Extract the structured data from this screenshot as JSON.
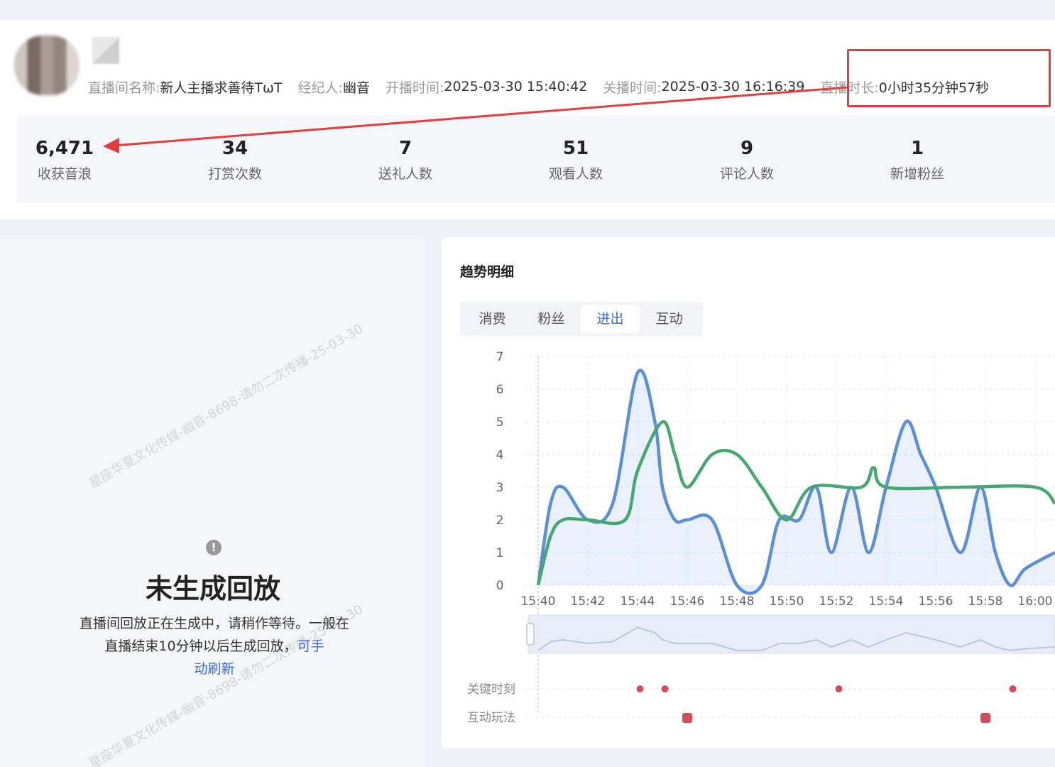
{
  "header": {
    "room_name_label": "直播间名称:",
    "room_name": "新人主播求善待TωT",
    "agent_label": "经纪人:",
    "agent": "幽音",
    "start_label": "开播时间:",
    "start_time": "2025-03-30 15:40:42",
    "end_label": "关播时间:",
    "end_time": "2025-03-30 16:16:39",
    "duration_label": "直播时长:",
    "duration": "0小时35分钟57秒"
  },
  "stats": [
    {
      "value": "6,471",
      "label": "收获音浪"
    },
    {
      "value": "34",
      "label": "打赏次数"
    },
    {
      "value": "7",
      "label": "送礼人数"
    },
    {
      "value": "51",
      "label": "观看人数"
    },
    {
      "value": "9",
      "label": "评论人数"
    },
    {
      "value": "1",
      "label": "新增粉丝"
    }
  ],
  "replay": {
    "warn_icon": "!",
    "title": "未生成回放",
    "desc": "直播间回放正在生成中，请稍作等待。一般在直播结束10分钟以后生成回放，",
    "desc_tail": "可手",
    "link": "动刷新"
  },
  "watermarks": [
    "星座华夏文化传媒-幽音-8698-请勿二次传播-25-03-30",
    "星座华夏文化传媒-幽音-8698-请勿二次传播-25-03-30"
  ],
  "trend": {
    "title": "趋势明细",
    "tabs": [
      "消费",
      "粉丝",
      "进出",
      "互动"
    ],
    "active_tab": "进出"
  },
  "colors": {
    "blue": "#5b8fd8",
    "green": "#45a870",
    "annotation_red": "#e43d3d",
    "marker_red": "#d34c5b"
  },
  "chart_data": {
    "type": "line",
    "x_ticks": [
      "15:40",
      "15:42",
      "15:44",
      "15:46",
      "15:48",
      "15:50",
      "15:52",
      "15:54",
      "15:56",
      "15:58",
      "16:00"
    ],
    "y_ticks": [
      "0",
      "1",
      "2",
      "3",
      "4",
      "5",
      "6",
      "7"
    ],
    "ylim": [
      0,
      7
    ],
    "xlim_minutes_from_start": [
      0,
      20.8
    ],
    "grid": true,
    "series": [
      {
        "color": "blue",
        "points": [
          [
            0,
            0
          ],
          [
            0.5,
            2.5
          ],
          [
            1,
            3
          ],
          [
            2,
            2
          ],
          [
            3,
            2.5
          ],
          [
            4,
            6.5
          ],
          [
            4.7,
            5
          ],
          [
            5,
            3
          ],
          [
            5.5,
            2
          ],
          [
            6,
            2
          ],
          [
            7,
            2
          ],
          [
            8,
            0
          ],
          [
            9,
            0
          ],
          [
            9.7,
            2
          ],
          [
            10.5,
            2
          ],
          [
            11.2,
            3
          ],
          [
            11.8,
            1
          ],
          [
            12.6,
            3
          ],
          [
            13.3,
            1
          ],
          [
            14,
            3
          ],
          [
            14.8,
            5
          ],
          [
            15.4,
            4
          ],
          [
            16,
            3
          ],
          [
            17,
            1
          ],
          [
            17.8,
            3
          ],
          [
            18.4,
            1
          ],
          [
            19,
            0
          ],
          [
            19.6,
            0.5
          ],
          [
            20.8,
            1
          ]
        ]
      },
      {
        "color": "green",
        "points": [
          [
            0,
            0
          ],
          [
            0.5,
            1.5
          ],
          [
            1,
            2
          ],
          [
            2,
            2
          ],
          [
            3.5,
            2
          ],
          [
            4,
            3.5
          ],
          [
            5,
            5
          ],
          [
            5.5,
            4
          ],
          [
            6,
            3
          ],
          [
            7,
            4
          ],
          [
            8,
            4
          ],
          [
            9,
            3
          ],
          [
            10,
            2
          ],
          [
            11,
            3
          ],
          [
            13,
            3
          ],
          [
            13.5,
            3.6
          ],
          [
            14,
            3
          ],
          [
            17,
            3
          ],
          [
            20,
            3
          ],
          [
            20.8,
            2.5
          ]
        ]
      }
    ],
    "key_moments_label": "关键时刻",
    "key_moments": [
      4.1,
      5.1,
      12.1,
      19.1
    ],
    "interactive_label": "互动玩法",
    "interactive_moments": [
      6.0,
      18.0
    ]
  }
}
